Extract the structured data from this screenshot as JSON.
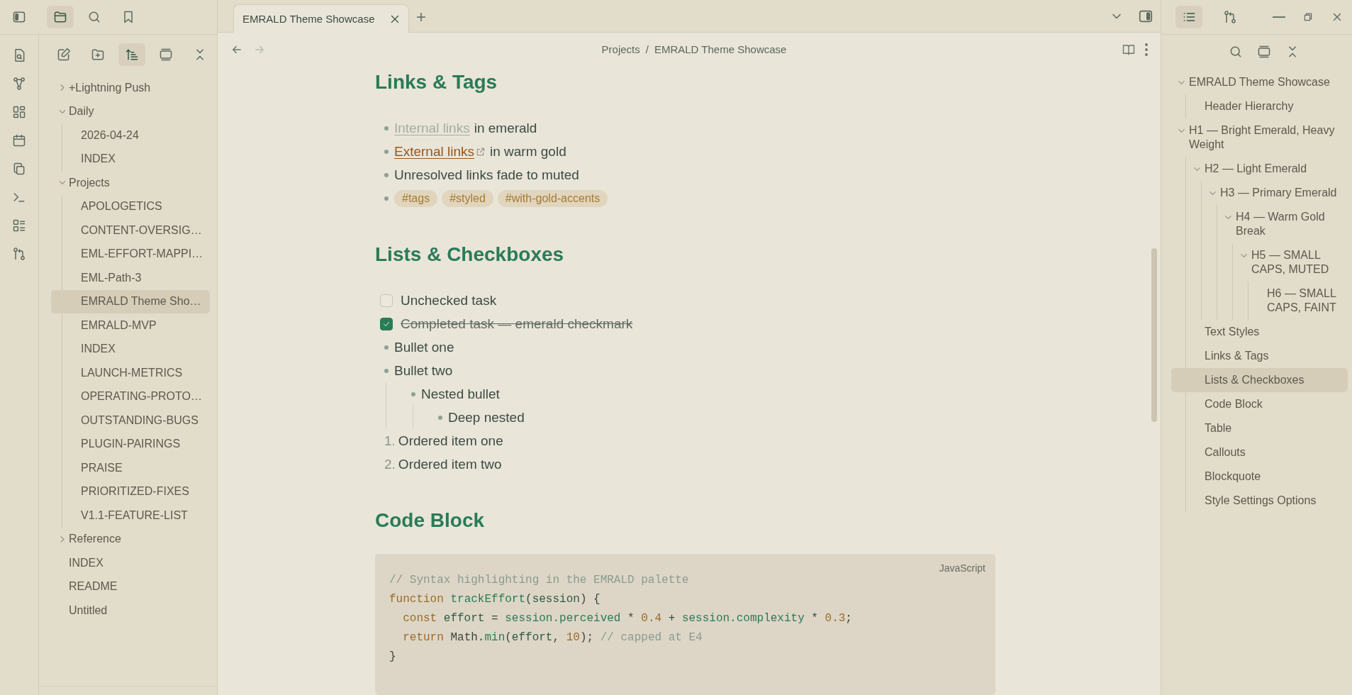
{
  "left_panel": {
    "tabs": [
      {
        "kind": "files",
        "selected": true
      },
      {
        "kind": "search",
        "selected": false
      },
      {
        "kind": "bookmarks",
        "selected": false
      }
    ],
    "toolbar": [
      {
        "kind": "new-note",
        "selected": false
      },
      {
        "kind": "new-folder",
        "selected": false
      },
      {
        "kind": "sort",
        "selected": true
      },
      {
        "kind": "collapse-view",
        "selected": false
      },
      {
        "kind": "collapse-all",
        "selected": false
      }
    ],
    "files": [
      {
        "label": "+Lightning Push",
        "kind": "folder",
        "expanded": false,
        "selected": false
      },
      {
        "label": "Daily",
        "kind": "folder",
        "expanded": true,
        "selected": false,
        "children": [
          {
            "label": "2026-04-24",
            "kind": "file",
            "selected": false
          },
          {
            "label": "INDEX",
            "kind": "file",
            "selected": false
          }
        ]
      },
      {
        "label": "Projects",
        "kind": "folder",
        "expanded": true,
        "selected": false,
        "children": [
          {
            "label": "APOLOGETICS",
            "kind": "file",
            "selected": false
          },
          {
            "label": "CONTENT-OVERSIG…",
            "kind": "file",
            "selected": false
          },
          {
            "label": "EML-EFFORT-MAPPI…",
            "kind": "file",
            "selected": false
          },
          {
            "label": "EML-Path-3",
            "kind": "file",
            "selected": false
          },
          {
            "label": "EMRALD Theme Sho…",
            "kind": "file",
            "selected": true
          },
          {
            "label": "EMRALD-MVP",
            "kind": "file",
            "selected": false
          },
          {
            "label": "INDEX",
            "kind": "file",
            "selected": false
          },
          {
            "label": "LAUNCH-METRICS",
            "kind": "file",
            "selected": false
          },
          {
            "label": "OPERATING-PROTO…",
            "kind": "file",
            "selected": false
          },
          {
            "label": "OUTSTANDING-BUGS",
            "kind": "file",
            "selected": false
          },
          {
            "label": "PLUGIN-PAIRINGS",
            "kind": "file",
            "selected": false
          },
          {
            "label": "PRAISE",
            "kind": "file",
            "selected": false
          },
          {
            "label": "PRIORITIZED-FIXES",
            "kind": "file",
            "selected": false
          },
          {
            "label": "V1.1-FEATURE-LIST",
            "kind": "file",
            "selected": false
          }
        ]
      },
      {
        "label": "Reference",
        "kind": "folder",
        "expanded": false,
        "selected": false
      },
      {
        "label": "INDEX",
        "kind": "file",
        "selected": false
      },
      {
        "label": "README",
        "kind": "file",
        "selected": false
      },
      {
        "label": "Untitled",
        "kind": "file",
        "selected": false
      }
    ]
  },
  "tabs": [
    {
      "title": "EMRALD Theme Showcase",
      "selected": true
    }
  ],
  "new_tab": "+",
  "nav": {
    "back_disabled": false,
    "forward_disabled": true,
    "breadcrumb": [
      "Projects",
      "EMRALD Theme Showcase"
    ],
    "separator": "/"
  },
  "content": [
    {
      "kind": "heading",
      "text": "Links & Tags"
    },
    {
      "kind": "bullet",
      "parts": [
        {
          "kind": "internal-link",
          "text": "Internal links"
        },
        {
          "kind": "text",
          "text": "in emerald"
        }
      ]
    },
    {
      "kind": "bullet",
      "parts": [
        {
          "kind": "external-link",
          "text": "External links"
        },
        {
          "kind": "text",
          "text": "in warm gold"
        }
      ]
    },
    {
      "kind": "bullet",
      "parts": [
        {
          "kind": "text",
          "text": "Unresolved links fade to muted"
        }
      ]
    },
    {
      "kind": "bullet",
      "parts": [
        {
          "kind": "tag",
          "text": "#tags"
        },
        {
          "kind": "tag",
          "text": "#styled"
        },
        {
          "kind": "tag",
          "text": "#with-gold-accents"
        }
      ]
    },
    {
      "kind": "heading",
      "text": "Lists & Checkboxes"
    },
    {
      "kind": "task",
      "text": "Unchecked task",
      "checked": false
    },
    {
      "kind": "task",
      "text": "Completed task — emerald checkmark",
      "checked": true
    },
    {
      "kind": "bullet",
      "parts": [
        {
          "kind": "text",
          "text": "Bullet one"
        }
      ]
    },
    {
      "kind": "bullet",
      "parts": [
        {
          "kind": "text",
          "text": "Bullet two"
        }
      ],
      "children": [
        {
          "kind": "bullet",
          "parts": [
            {
              "kind": "text",
              "text": "Nested bullet"
            }
          ],
          "children": [
            {
              "kind": "bullet",
              "parts": [
                {
                  "kind": "text",
                  "text": "Deep nested"
                }
              ]
            }
          ]
        }
      ]
    },
    {
      "kind": "ordered",
      "number": "1.",
      "text": "Ordered item one"
    },
    {
      "kind": "ordered",
      "number": "2.",
      "text": "Ordered item two"
    },
    {
      "kind": "heading",
      "text": "Code Block"
    },
    {
      "kind": "code",
      "language": "JavaScript",
      "lines": [
        {
          "indented": false,
          "tokens": [
            {
              "kind": "comment",
              "text": "// Syntax highlighting in the EMRALD palette"
            }
          ]
        },
        {
          "indented": false,
          "tokens": [
            {
              "kind": "keyword",
              "text": "function "
            },
            {
              "kind": "func",
              "text": "trackEffort"
            },
            {
              "kind": "plain",
              "text": "("
            },
            {
              "kind": "var",
              "text": "session"
            },
            {
              "kind": "plain",
              "text": ") {"
            }
          ]
        },
        {
          "indented": true,
          "tokens": [
            {
              "kind": "keyword",
              "text": "const "
            },
            {
              "kind": "var",
              "text": "effort"
            },
            {
              "kind": "plain",
              "text": " = "
            },
            {
              "kind": "func",
              "text": "session.perceived"
            },
            {
              "kind": "plain",
              "text": " * "
            },
            {
              "kind": "number",
              "text": "0.4"
            },
            {
              "kind": "plain",
              "text": " + "
            },
            {
              "kind": "func",
              "text": "session.complexity"
            },
            {
              "kind": "plain",
              "text": " * "
            },
            {
              "kind": "number",
              "text": "0.3"
            },
            {
              "kind": "plain",
              "text": ";"
            }
          ]
        },
        {
          "indented": true,
          "tokens": [
            {
              "kind": "keyword",
              "text": "return "
            },
            {
              "kind": "plain",
              "text": "Math."
            },
            {
              "kind": "func",
              "text": "min"
            },
            {
              "kind": "plain",
              "text": "("
            },
            {
              "kind": "var",
              "text": "effort"
            },
            {
              "kind": "plain",
              "text": ", "
            },
            {
              "kind": "number",
              "text": "10"
            },
            {
              "kind": "plain",
              "text": "); "
            },
            {
              "kind": "comment",
              "text": "// capped at E4"
            }
          ]
        },
        {
          "indented": false,
          "tokens": [
            {
              "kind": "plain",
              "text": "}"
            }
          ]
        }
      ]
    }
  ],
  "outline": {
    "items": [
      {
        "label": "EMRALD Theme Showcase",
        "selected": false,
        "expanded": true,
        "children": [
          {
            "label": "Header Hierarchy",
            "selected": false
          }
        ]
      },
      {
        "label": "H1 — Bright Emerald, Heavy Weight",
        "selected": false,
        "expanded": true,
        "children": [
          {
            "label": "H2 — Light Emerald",
            "selected": false,
            "expanded": true,
            "children": [
              {
                "label": "H3 — Primary Emerald",
                "selected": false,
                "expanded": true,
                "children": [
                  {
                    "label": "H4 — Warm Gold Break",
                    "selected": false,
                    "expanded": true,
                    "children": [
                      {
                        "label": "H5 — SMALL CAPS, MUTED",
                        "selected": false,
                        "expanded": true,
                        "children": [
                          {
                            "label": "H6 — SMALL CAPS, FAINT",
                            "selected": false
                          }
                        ]
                      }
                    ]
                  }
                ]
              }
            ]
          },
          {
            "label": "Text Styles",
            "selected": false
          },
          {
            "label": "Links & Tags",
            "selected": false
          },
          {
            "label": "Lists & Checkboxes",
            "selected": true
          },
          {
            "label": "Code Block",
            "selected": false
          },
          {
            "label": "Table",
            "selected": false
          },
          {
            "label": "Callouts",
            "selected": false
          },
          {
            "label": "Blockquote",
            "selected": false
          },
          {
            "label": "Style Settings Options",
            "selected": false
          }
        ]
      }
    ]
  }
}
